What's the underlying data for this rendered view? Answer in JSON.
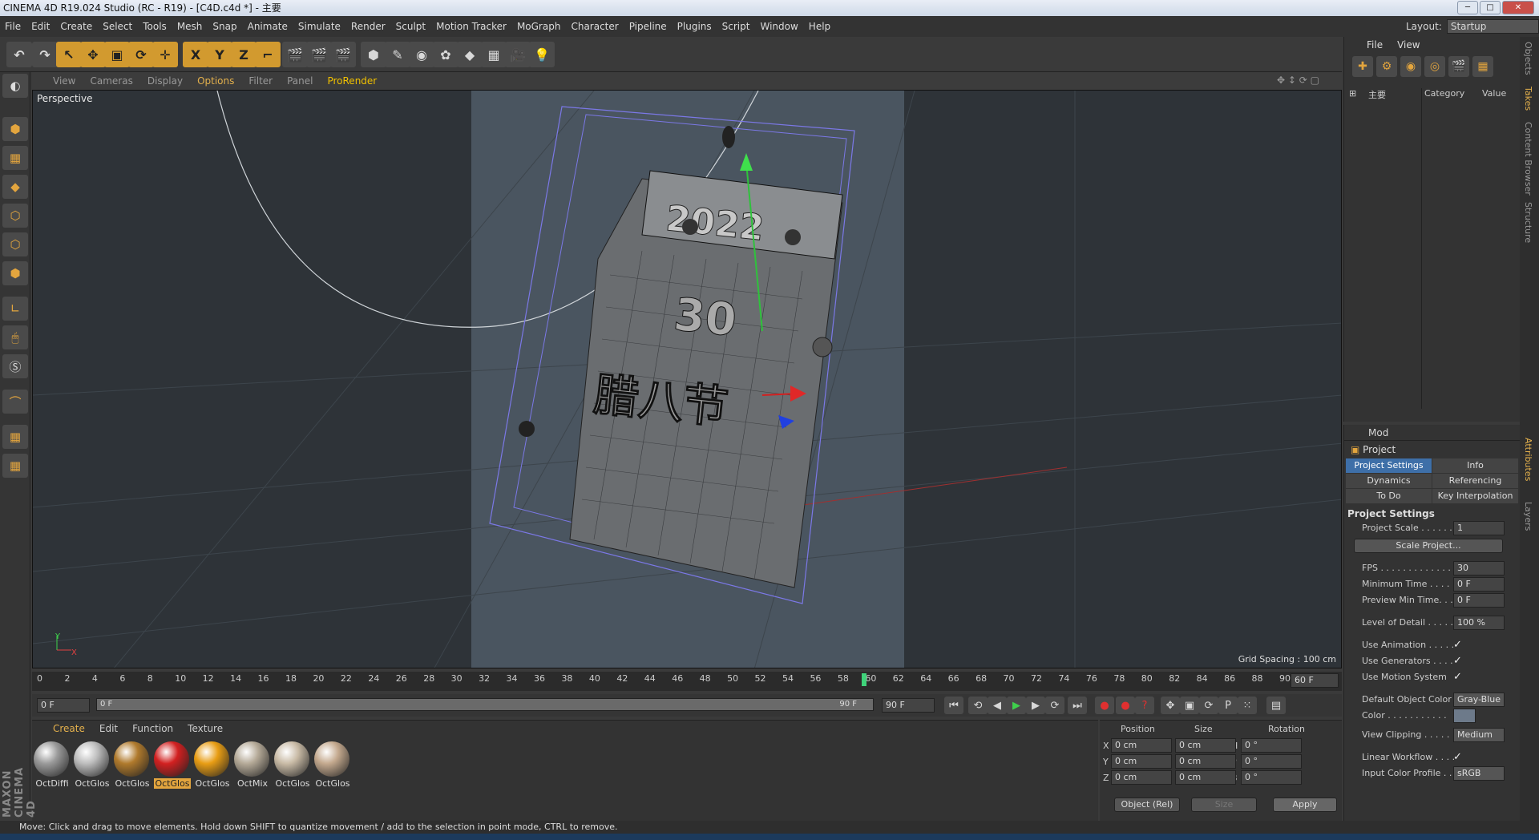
{
  "title": "CINEMA 4D R19.024 Studio (RC - R19) - [C4D.c4d *] - 主要",
  "window_buttons": [
    "─",
    "□",
    "✕"
  ],
  "menu": [
    "File",
    "Edit",
    "Create",
    "Select",
    "Tools",
    "Mesh",
    "Snap",
    "Animate",
    "Simulate",
    "Render",
    "Sculpt",
    "Motion Tracker",
    "MoGraph",
    "Character",
    "Pipeline",
    "Plugins",
    "Script",
    "Window",
    "Help"
  ],
  "layout": {
    "label": "Layout:",
    "value": "Startup"
  },
  "toolbar_icons": [
    "undo-icon",
    "redo-icon",
    "select-icon",
    "move-icon",
    "scale-icon",
    "rotate-icon",
    "transform-icon",
    "x-axis-icon",
    "y-axis-icon",
    "z-axis-icon",
    "coord-system-icon",
    "render-view-icon",
    "render-picture-viewer-icon",
    "edit-render-settings-icon",
    "cube-icon",
    "pen-icon",
    "nurbs-icon",
    "array-icon",
    "deformer-icon",
    "floor-icon",
    "camera-icon",
    "light-icon"
  ],
  "toolbar_glyphs": [
    "↶",
    "↷",
    "↖",
    "✥",
    "▣",
    "⟳",
    "✛",
    "X",
    "Y",
    "Z",
    "⌐",
    "🎬",
    "🎬",
    "🎬",
    "⬢",
    "✎",
    "◉",
    "✿",
    "◆",
    "▦",
    "🎥",
    "💡"
  ],
  "viewport": {
    "menu": [
      "View",
      "Cameras",
      "Display",
      "Options",
      "Filter",
      "Panel",
      "ProRender"
    ],
    "label": "Perspective",
    "grid_spacing": "Grid Spacing : 100 cm",
    "nav_icons": "✥ ↕ ⟳ ▢",
    "axis_y": "Y",
    "axis_x": "X",
    "text_year": "2022",
    "text_30": "30",
    "text_cn": "腊八节"
  },
  "timeline": {
    "ticks": [
      "0",
      "2",
      "4",
      "6",
      "8",
      "10",
      "12",
      "14",
      "16",
      "18",
      "20",
      "22",
      "24",
      "26",
      "28",
      "30",
      "32",
      "34",
      "36",
      "38",
      "40",
      "42",
      "44",
      "46",
      "48",
      "50",
      "52",
      "54",
      "56",
      "58",
      "60",
      "62",
      "64",
      "66",
      "68",
      "70",
      "72",
      "74",
      "76",
      "78",
      "80",
      "82",
      "84",
      "86",
      "88",
      "90"
    ],
    "current_frame": 60,
    "end_field": "60 F"
  },
  "controls": {
    "start": "0 F",
    "slider_start": "0 F",
    "slider_end": "90 F",
    "end": "90 F",
    "buttons": [
      "⏮",
      "⟲",
      "◀",
      "▶",
      "▶",
      "⟳",
      "⏭",
      "●",
      "●",
      "?",
      "✥",
      "▣",
      "⟳",
      "P",
      "⁙",
      "▤"
    ]
  },
  "materials": {
    "menu": [
      "Create",
      "Edit",
      "Function",
      "Texture"
    ],
    "items": [
      {
        "name": "OctDiffi",
        "color": "#9a9a9a"
      },
      {
        "name": "OctGlos",
        "color": "#bdbdbd"
      },
      {
        "name": "OctGlos",
        "color": "#b07a2c"
      },
      {
        "name": "OctGlos",
        "color": "#d22020",
        "selected": true
      },
      {
        "name": "OctGlos",
        "color": "#e89d14"
      },
      {
        "name": "OctMix",
        "color": "#b5aa98"
      },
      {
        "name": "OctGlos",
        "color": "#c9bba6"
      },
      {
        "name": "OctGlos",
        "color": "#c4a98e"
      }
    ]
  },
  "maxon": "MAXON CINEMA 4D",
  "coords": {
    "headers": [
      "Position",
      "Size",
      "Rotation"
    ],
    "rows": [
      {
        "a": "X",
        "pos": "0 cm",
        "b": "X",
        "size": "0 cm",
        "c": "H",
        "rot": "0 °"
      },
      {
        "a": "Y",
        "pos": "0 cm",
        "b": "Y",
        "size": "0 cm",
        "c": "P",
        "rot": "0 °"
      },
      {
        "a": "Z",
        "pos": "0 cm",
        "b": "Z",
        "size": "0 cm",
        "c": "B",
        "rot": "0 °"
      }
    ],
    "mode": "Object (Rel)",
    "size_mode": "Size",
    "apply": "Apply"
  },
  "status": "Move: Click and drag to move elements. Hold down SHIFT to quantize movement / add to the selection in point mode, CTRL to remove.",
  "objects": {
    "menu": [
      "File",
      "View"
    ],
    "icon_glyphs": [
      "✚",
      "⚙",
      "◉",
      "◎",
      "🎬",
      "▦"
    ],
    "tree_item": "主要",
    "col_category": "Category",
    "col_value": "Value"
  },
  "attributes": {
    "mode": "Mod",
    "title": "Project",
    "tabs": [
      {
        "label": "Project Settings",
        "active": true
      },
      {
        "label": "Info"
      },
      {
        "label": "Dynamics"
      },
      {
        "label": "Referencing"
      },
      {
        "label": "To Do"
      },
      {
        "label": "Key Interpolation"
      }
    ],
    "section": "Project Settings",
    "project_scale_label": "Project Scale . . . . . . .",
    "project_scale": "1",
    "scale_button": "Scale Project...",
    "fps_label": "FPS . . . . . . . . . . . . . .",
    "fps": "30",
    "min_time_label": "Minimum Time . . . . .",
    "min_time": "0 F",
    "preview_min_label": "Preview Min Time. . .",
    "preview_min": "0 F",
    "lod_label": "Level of Detail . . . . .",
    "lod": "100 %",
    "use_anim_label": "Use Animation . . . . .",
    "use_gen_label": "Use Generators . . . .",
    "use_motion_label": "Use Motion System",
    "check": "✓",
    "def_color_label": "Default Object Color",
    "def_color": "Gray-Blue",
    "color_label": "Color . . . . . . . . . . .",
    "view_clip_label": "View Clipping . . . . . .",
    "view_clip": "Medium",
    "linear_label": "Linear Workflow . . . .",
    "input_profile_label": "Input Color Profile . . .",
    "input_profile": "sRGB"
  },
  "side_tabs": [
    "Objects",
    "Takes",
    "Content Browser",
    "Structure",
    "Attributes",
    "Layers"
  ]
}
